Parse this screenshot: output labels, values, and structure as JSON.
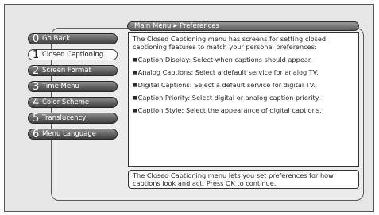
{
  "breadcrumb": {
    "root": "Main Menu",
    "separator": "▶",
    "current": "Preferences"
  },
  "menu": [
    {
      "number": "0",
      "label": "Go Back"
    },
    {
      "number": "1",
      "label": "Closed Captioning"
    },
    {
      "number": "2",
      "label": "Screen Format"
    },
    {
      "number": "3",
      "label": "Time Menu"
    },
    {
      "number": "4",
      "label": "Color Scheme"
    },
    {
      "number": "5",
      "label": "Translucency"
    },
    {
      "number": "6",
      "label": "Menu Language"
    }
  ],
  "selected_index": 1,
  "content": {
    "intro": "The Closed Captioning menu has screens for setting closed captioning features to match your personal preferences:",
    "bullet_glyph": "■",
    "bullets": [
      "Caption Display: Select when captions should appear.",
      "Analog Captions: Select a default service for analog TV.",
      "Digital Captions: Select a default service for digital TV.",
      "Caption Priority: Select digital or analog caption priority.",
      "Caption Style: Select the appearance of digital captions."
    ]
  },
  "footer": "The Closed Captioning menu lets you set preferences for how captions look and act. Press OK to continue.",
  "colors": {
    "button_top": "#8d8d8d",
    "button_bottom": "#3f3f3f",
    "background": "#e6e6e6"
  }
}
